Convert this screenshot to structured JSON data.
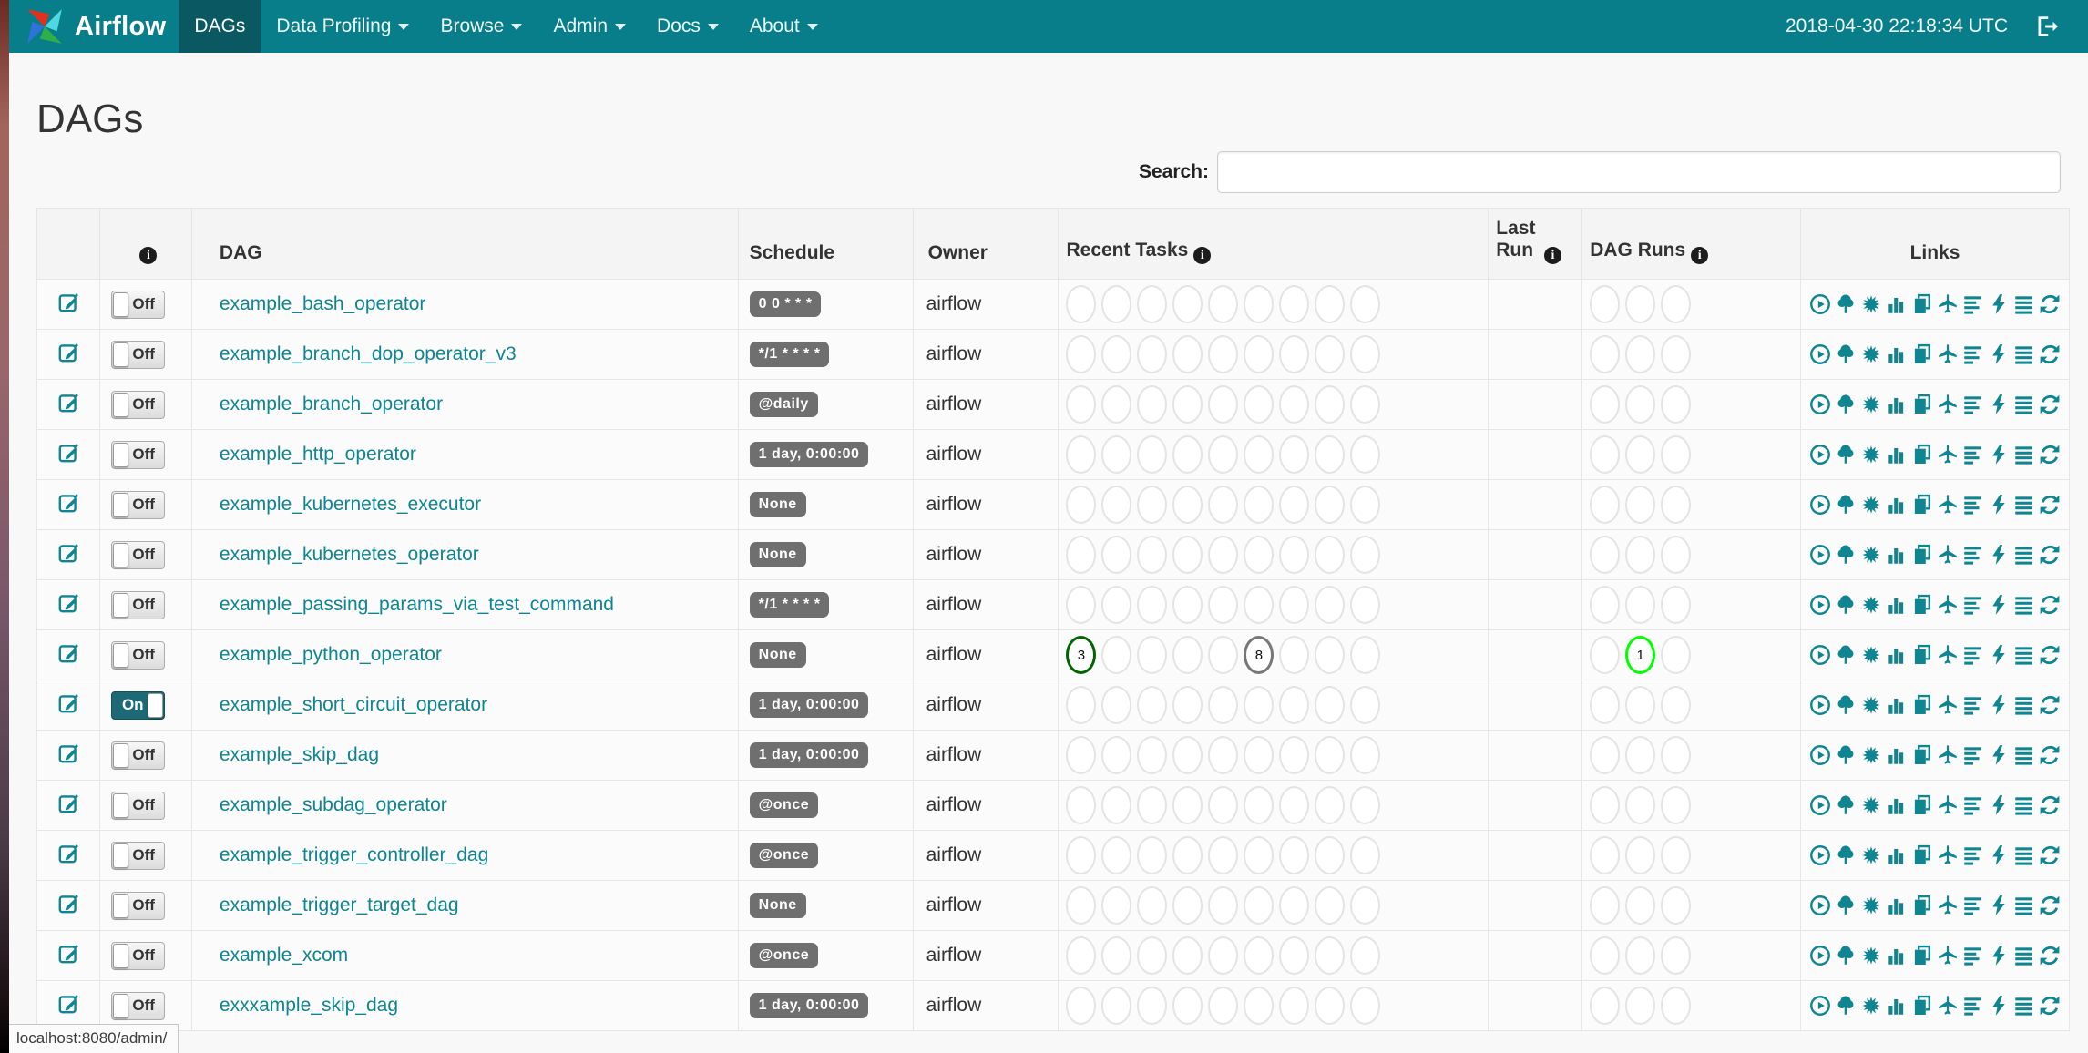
{
  "navbar": {
    "brand": "Airflow",
    "items": [
      {
        "label": "DAGs",
        "active": true,
        "caret": false
      },
      {
        "label": "Data Profiling",
        "active": false,
        "caret": true
      },
      {
        "label": "Browse",
        "active": false,
        "caret": true
      },
      {
        "label": "Admin",
        "active": false,
        "caret": true
      },
      {
        "label": "Docs",
        "active": false,
        "caret": true
      },
      {
        "label": "About",
        "active": false,
        "caret": true
      }
    ],
    "clock": "2018-04-30 22:18:34 UTC",
    "logout_icon": "sign-out-icon"
  },
  "page": {
    "title": "DAGs",
    "search_label": "Search:",
    "search_value": "",
    "status_tooltip": "localhost:8080/admin/"
  },
  "table": {
    "headers": {
      "info": "info-icon",
      "dag": "DAG",
      "schedule": "Schedule",
      "owner": "Owner",
      "recent_tasks": "Recent Tasks",
      "last_run": "Last Run",
      "dag_runs": "DAG Runs",
      "links": "Links"
    },
    "recent_task_slots": 9,
    "dag_run_slots": 3,
    "links": [
      "trigger-dag",
      "tree-view",
      "graph-view",
      "task-duration",
      "task-tries",
      "landing-times",
      "gantt",
      "code-view",
      "logs",
      "refresh"
    ],
    "rows": [
      {
        "name": "example_bash_operator",
        "toggle": "Off",
        "schedule": "0 0 * * *",
        "owner": "airflow",
        "last_run": "",
        "recent_tasks": [],
        "dag_runs": []
      },
      {
        "name": "example_branch_dop_operator_v3",
        "toggle": "Off",
        "schedule": "*/1 * * * *",
        "owner": "airflow",
        "last_run": "",
        "recent_tasks": [],
        "dag_runs": []
      },
      {
        "name": "example_branch_operator",
        "toggle": "Off",
        "schedule": "@daily",
        "owner": "airflow",
        "last_run": "",
        "recent_tasks": [],
        "dag_runs": []
      },
      {
        "name": "example_http_operator",
        "toggle": "Off",
        "schedule": "1 day, 0:00:00",
        "owner": "airflow",
        "last_run": "",
        "recent_tasks": [],
        "dag_runs": []
      },
      {
        "name": "example_kubernetes_executor",
        "toggle": "Off",
        "schedule": "None",
        "owner": "airflow",
        "last_run": "",
        "recent_tasks": [],
        "dag_runs": []
      },
      {
        "name": "example_kubernetes_operator",
        "toggle": "Off",
        "schedule": "None",
        "owner": "airflow",
        "last_run": "",
        "recent_tasks": [],
        "dag_runs": []
      },
      {
        "name": "example_passing_params_via_test_command",
        "toggle": "Off",
        "schedule": "*/1 * * * *",
        "owner": "airflow",
        "last_run": "",
        "recent_tasks": [],
        "dag_runs": []
      },
      {
        "name": "example_python_operator",
        "toggle": "Off",
        "schedule": "None",
        "owner": "airflow",
        "last_run": "",
        "recent_tasks": [
          {
            "slot": 0,
            "count": "3",
            "color": "#006400"
          },
          {
            "slot": 5,
            "count": "8",
            "color": "#777777"
          }
        ],
        "dag_runs": [
          {
            "slot": 1,
            "count": "1",
            "color": "#00ff00"
          }
        ]
      },
      {
        "name": "example_short_circuit_operator",
        "toggle": "On",
        "schedule": "1 day, 0:00:00",
        "owner": "airflow",
        "last_run": "",
        "recent_tasks": [],
        "dag_runs": []
      },
      {
        "name": "example_skip_dag",
        "toggle": "Off",
        "schedule": "1 day, 0:00:00",
        "owner": "airflow",
        "last_run": "",
        "recent_tasks": [],
        "dag_runs": []
      },
      {
        "name": "example_subdag_operator",
        "toggle": "Off",
        "schedule": "@once",
        "owner": "airflow",
        "last_run": "",
        "recent_tasks": [],
        "dag_runs": []
      },
      {
        "name": "example_trigger_controller_dag",
        "toggle": "Off",
        "schedule": "@once",
        "owner": "airflow",
        "last_run": "",
        "recent_tasks": [],
        "dag_runs": []
      },
      {
        "name": "example_trigger_target_dag",
        "toggle": "Off",
        "schedule": "None",
        "owner": "airflow",
        "last_run": "",
        "recent_tasks": [],
        "dag_runs": []
      },
      {
        "name": "example_xcom",
        "toggle": "Off",
        "schedule": "@once",
        "owner": "airflow",
        "last_run": "",
        "recent_tasks": [],
        "dag_runs": []
      },
      {
        "name": "exxxample_skip_dag",
        "toggle": "Off",
        "schedule": "1 day, 0:00:00",
        "owner": "airflow",
        "last_run": "",
        "recent_tasks": [],
        "dag_runs": []
      }
    ]
  },
  "colors": {
    "navbar_bg": "#087e8b",
    "navbar_active_bg": "#095862",
    "link_teal": "#0e8591",
    "badge_gray": "#6f6f6f",
    "task_success_border": "#006400",
    "task_none_border": "#777777",
    "dagrun_running_border": "#00ff00"
  }
}
